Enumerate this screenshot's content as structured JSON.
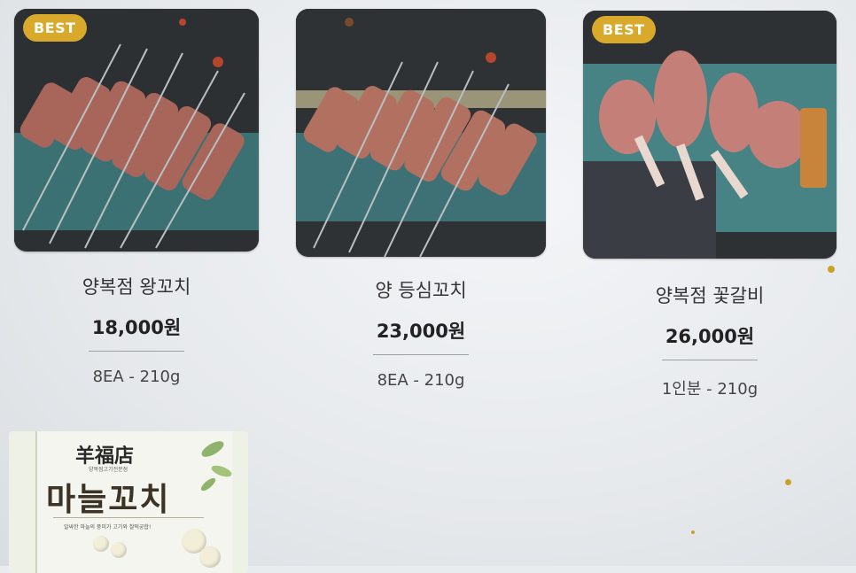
{
  "products": [
    {
      "badge": "BEST",
      "name": "양복점 왕꼬치",
      "price": "18,000원",
      "meta": "8EA - 210g",
      "image": "lamb-skewers-photo"
    },
    {
      "badge": "",
      "name": "양 등심꼬치",
      "price": "23,000원",
      "meta": "8EA - 210g",
      "image": "lamb-loin-skewers-photo"
    },
    {
      "badge": "BEST",
      "name": "양복점 꽃갈비",
      "price": "26,000원",
      "meta": "1인분 - 210g",
      "image": "lamb-rack-photo"
    }
  ],
  "banner": {
    "brand_hanja": "羊福店",
    "tagline_small": "양복점고기전문점",
    "title": "마늘꼬치",
    "subtitle": "알싸한 마늘의 풍미가 고기와 찰떡궁합!"
  }
}
